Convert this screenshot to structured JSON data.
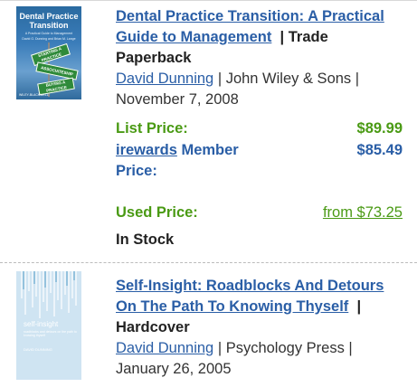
{
  "items": [
    {
      "title": "Dental Practice Transition: A Practical Guide to Management",
      "format": "Trade Paperback",
      "author": "David Dunning",
      "publisher_date": " | John Wiley & Sons | November 7, 2008",
      "list_price_label": "List Price:",
      "list_price": "$89.99",
      "member_link": "irewards",
      "member_label": " Member Price:",
      "member_price": "$85.49",
      "used_label": "Used Price:",
      "used_price": "from $73.25",
      "stock": "In Stock",
      "cover": {
        "title": "Dental Practice Transition",
        "subtitle": "A Practical Guide to Management",
        "authors": "David G. Dunning and Brian M. Lange",
        "sign1": "STARTING A PRACTICE",
        "sign2": "ASSOCIATESHIP",
        "sign3": "BUYING A PRACTICE",
        "publisher": "WILEY-BLACKWELL"
      }
    },
    {
      "title": "Self-Insight: Roadblocks And Detours On The Path To Knowing Thyself",
      "format": "Hardcover",
      "author": "David Dunning",
      "publisher_date": " | Psychology Press | January 26, 2005",
      "cover": {
        "title": "self-insight",
        "subtitle": "roadblocks and detours on the path to knowing thyself",
        "author": "DAVID DUNNING"
      }
    }
  ],
  "colors": {
    "link": "#2a5ea6",
    "price_green": "#4a9a14",
    "divider": "#bbbbbb"
  }
}
